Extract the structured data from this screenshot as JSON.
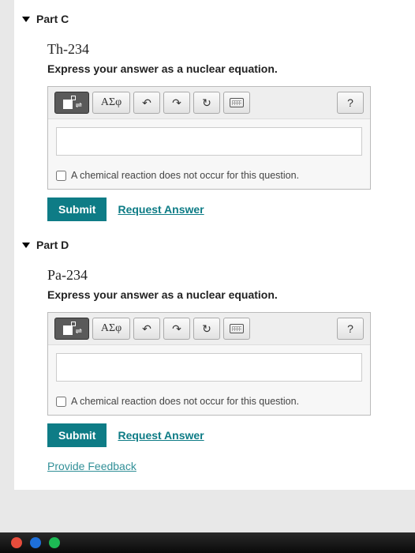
{
  "parts": [
    {
      "header": "Part C",
      "isotope": "Th-234",
      "instruction": "Express your answer as a nuclear equation.",
      "greek_label": "ΑΣφ",
      "help_label": "?",
      "checkbox_label": "A chemical reaction does not occur for this question.",
      "submit_label": "Submit",
      "request_label": "Request Answer"
    },
    {
      "header": "Part D",
      "isotope": "Pa-234",
      "instruction": "Express your answer as a nuclear equation.",
      "greek_label": "ΑΣφ",
      "help_label": "?",
      "checkbox_label": "A chemical reaction does not occur for this question.",
      "submit_label": "Submit",
      "request_label": "Request Answer"
    }
  ],
  "feedback_label": "Provide Feedback"
}
